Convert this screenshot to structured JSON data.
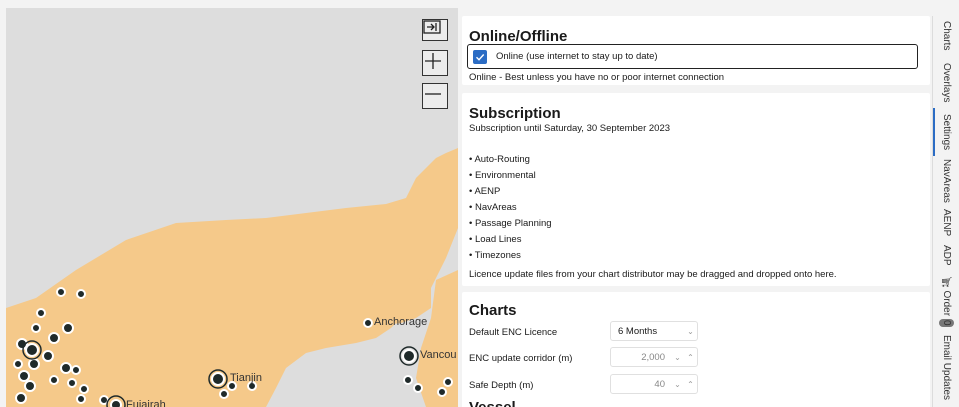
{
  "map": {
    "controls": [
      "expand-icon",
      "zoom-in-icon",
      "zoom-out-icon"
    ],
    "labels": {
      "anchorage": "Anchorage",
      "vancouver": "Vancou",
      "tianjin": "Tianjin",
      "fujairah": "Fujairah"
    },
    "colors": {
      "land": "#f5c98a",
      "sea": "#dddddd",
      "marker": "#1f2a2a"
    }
  },
  "online": {
    "title": "Online/Offline",
    "checkbox_label": "Online (use internet to stay up to date)",
    "checked": true,
    "note": "Online - Best unless you have no or poor internet connection"
  },
  "subscription": {
    "title": "Subscription",
    "until": "Subscription until Saturday, 30 September 2023",
    "features": [
      "• Auto-Routing",
      "• Environmental",
      "• AENP",
      "• NavAreas",
      "• Passage Planning",
      "• Load Lines",
      "• Timezones"
    ],
    "licence_note": "Licence update files from your chart distributor may be dragged and dropped onto here."
  },
  "charts": {
    "title": "Charts",
    "fields": [
      {
        "label": "Default ENC Licence",
        "value": "6 Months"
      },
      {
        "label": "ENC update corridor (m)",
        "value": "2,000"
      },
      {
        "label": "Safe Depth (m)",
        "value": "40"
      }
    ],
    "next_section": "Vessel"
  },
  "tabs": {
    "charts": "Charts",
    "overlays": "Overlays",
    "settings": "Settings",
    "navareas": "NavAreas",
    "aenp": "AENP",
    "adp": "ADP",
    "order": "Order",
    "order_count": "0",
    "email_updates": "Email Updates"
  },
  "colors": {
    "accent": "#2b6cc4"
  }
}
